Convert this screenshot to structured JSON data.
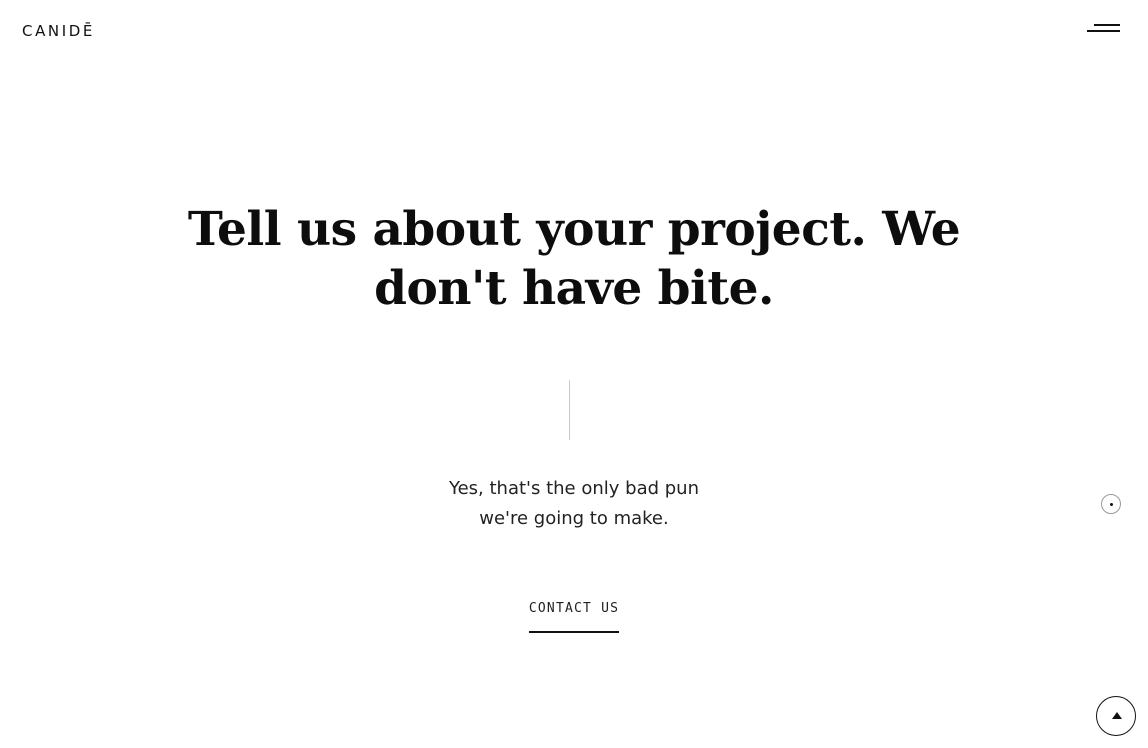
{
  "header": {
    "logo_text": "CANIDĒ",
    "menu_icon": "hamburger-menu-icon"
  },
  "hero": {
    "headline_line1": "Tell us about your project. We",
    "headline_line2": "don't have bite.",
    "subtext_line1": "Yes, that's the only bad pun",
    "subtext_line2": "we're going to make.",
    "cta_label": "CONTACT US"
  },
  "controls": {
    "indicator_icon": "dot-indicator-icon",
    "scroll_top_icon": "arrow-up-icon"
  },
  "colors": {
    "background": "#ffffff",
    "text": "#111111",
    "divider": "#c8c8c8"
  }
}
